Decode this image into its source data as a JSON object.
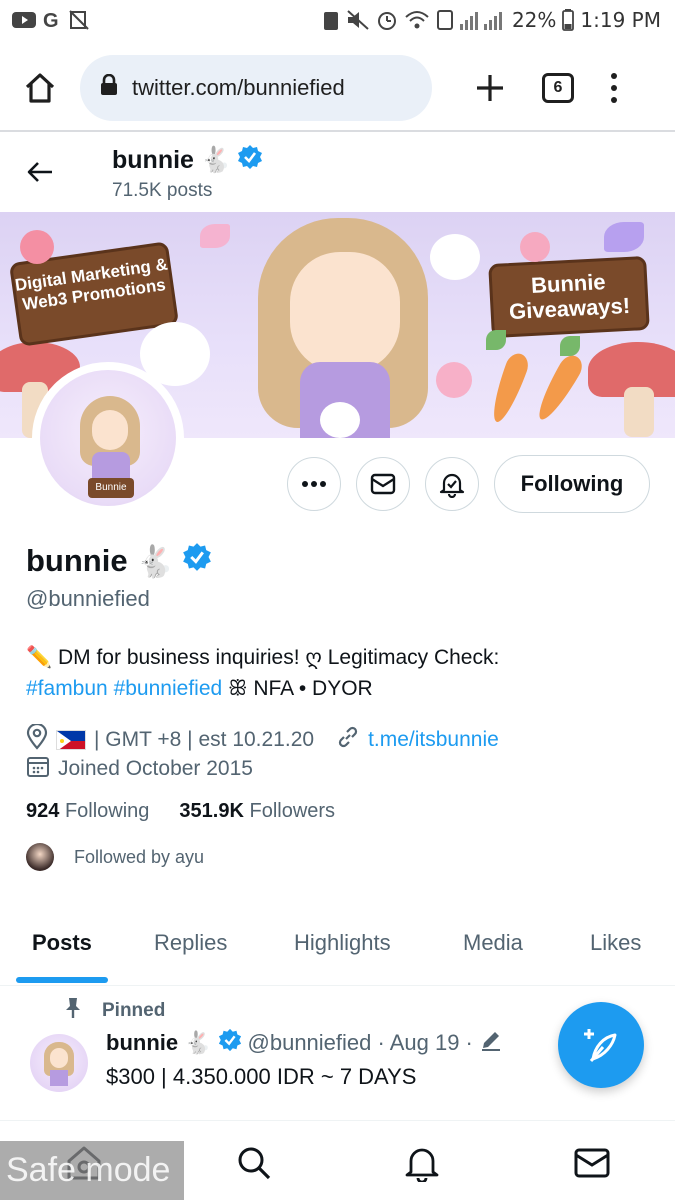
{
  "status_bar": {
    "battery": "22%",
    "time": "1:19 PM"
  },
  "browser": {
    "url": "twitter.com/bunniefied",
    "tab_count": "6"
  },
  "header": {
    "name": "bunnie",
    "posts": "71.5K posts"
  },
  "banner": {
    "left_sign": "Digital Marketing & Web3 Promotions",
    "right_sign": "Bunnie Giveaways!",
    "avatar_sign": "Bunnie"
  },
  "actions": {
    "following_label": "Following"
  },
  "profile": {
    "display_name": "bunnie",
    "emoji": "🐇",
    "handle": "@bunniefied",
    "bio_line1": "✏️ DM for business inquiries! ღ Legitimacy Check:",
    "bio_tag1": "#fambun",
    "bio_tag2": "#bunniefied",
    "bio_rest": " ꕥ NFA • DYOR",
    "location": " | GMT +8 | est 10.21.20",
    "link": "t.me/itsbunnie",
    "joined": "Joined October 2015",
    "following_count": "924",
    "following_label": "Following",
    "followers_count": "351.9K",
    "followers_label": "Followers",
    "followed_by": "Followed by ayu"
  },
  "tabs": [
    {
      "label": "Posts"
    },
    {
      "label": "Replies"
    },
    {
      "label": "Highlights"
    },
    {
      "label": "Media"
    },
    {
      "label": "Likes"
    }
  ],
  "pinned_post": {
    "pinned_label": "Pinned",
    "name": "bunnie",
    "emoji": "🐇",
    "meta": "@bunniefied · Aug 19 ·",
    "text": "$300 | 4.350.000 IDR ~ 7 DAYS"
  },
  "overlay": {
    "safe_mode": "Safe mode"
  },
  "colors": {
    "accent": "#1d9bf0",
    "muted_text": "#536471",
    "primary_text": "#0f1419"
  }
}
